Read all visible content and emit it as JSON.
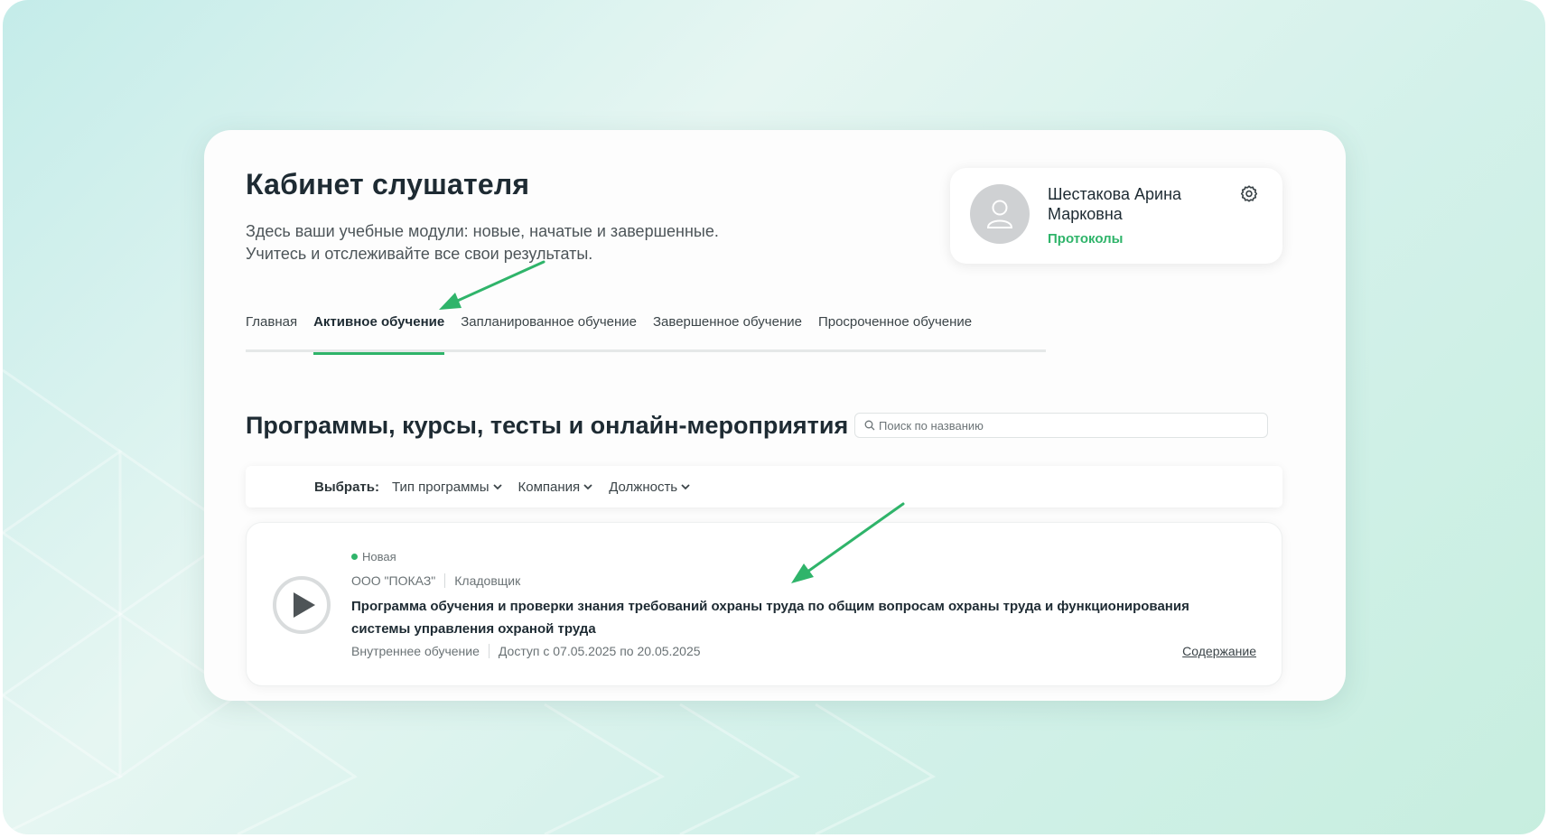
{
  "header": {
    "title": "Кабинет слушателя",
    "description_line1": "Здесь ваши учебные модули: новые, начатые и завершенные.",
    "description_line2": "Учитесь и отслеживайте все свои результаты."
  },
  "profile": {
    "name": "Шестакова Арина Марковна",
    "link_label": "Протоколы"
  },
  "tabs": [
    {
      "label": "Главная",
      "active": false
    },
    {
      "label": "Активное обучение",
      "active": true
    },
    {
      "label": "Запланированное обучение",
      "active": false
    },
    {
      "label": "Завершенное обучение",
      "active": false
    },
    {
      "label": "Просроченное обучение",
      "active": false
    }
  ],
  "section": {
    "title": "Программы, курсы, тесты и онлайн-мероприятия",
    "search_placeholder": "Поиск по названию"
  },
  "filters": {
    "label": "Выбрать:",
    "items": [
      "Тип программы",
      "Компания",
      "Должность"
    ]
  },
  "course": {
    "status": "Новая",
    "company": "ООО \"ПОКАЗ\"",
    "position": "Кладовщик",
    "title": "Программа обучения и проверки знания требований охраны труда по общим вопросам охраны труда и функционирования системы управления охраной труда",
    "type": "Внутреннее обучение",
    "access": "Доступ с 07.05.2025 по 20.05.2025",
    "contents_label": "Содержание"
  },
  "colors": {
    "accent": "#2fb46a",
    "text_dark": "#1e2b33",
    "annotation_arrow": "#2fb46a"
  }
}
